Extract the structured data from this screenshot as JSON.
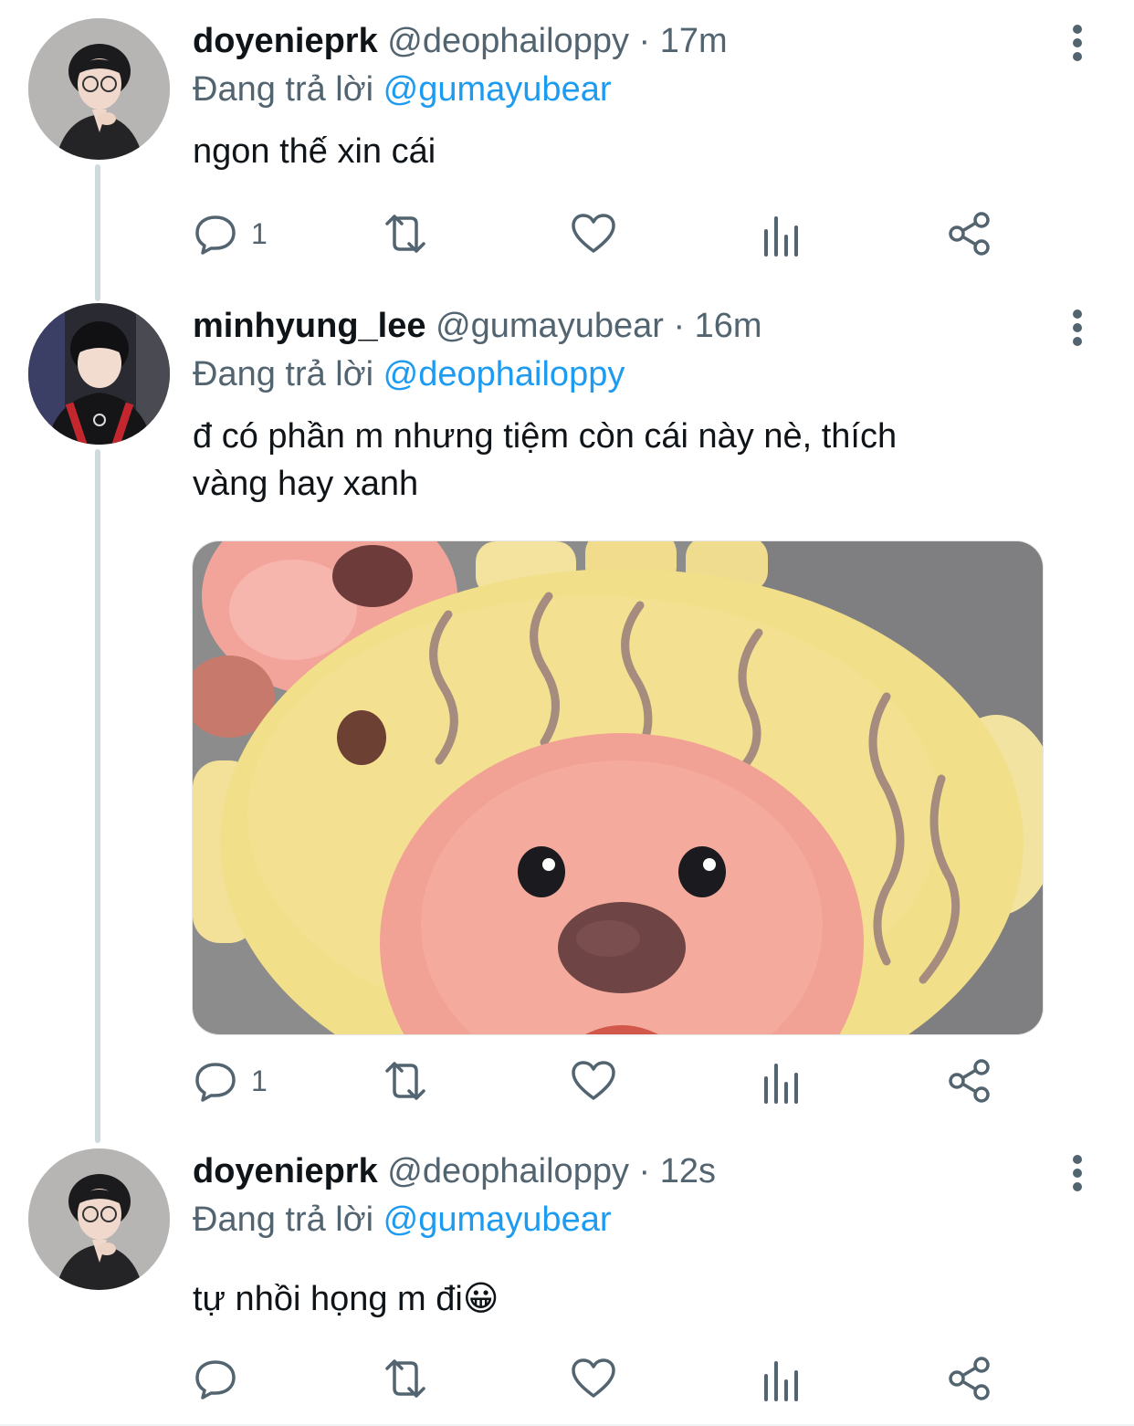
{
  "tweets": [
    {
      "name": "doyenieprk",
      "handle": "@deophailoppy",
      "time": "· 17m",
      "reply_prefix": "Đang trả lời",
      "reply_to": "@gumayubear",
      "text": "ngon thế xin cái",
      "reply_count": "1"
    },
    {
      "name": "minhyung_lee",
      "handle": "@gumayubear",
      "time": "· 16m",
      "reply_prefix": "Đang trả lời",
      "reply_to": "@deophailoppy",
      "text_line1": "đ có phần m nhưng tiệm còn cái này nè, thích",
      "text_line2": "vàng hay xanh",
      "reply_count": "1"
    },
    {
      "name": "doyenieprk",
      "handle": "@deophailoppy",
      "time": "· 12s",
      "reply_prefix": "Đang trả lời",
      "reply_to": "@gumayubear",
      "text": "tự nhồi họng m đi",
      "emoji": "😀",
      "reply_count": ""
    }
  ],
  "icons": {
    "reply": "reply-icon",
    "retweet": "retweet-icon",
    "like": "heart-icon",
    "views": "analytics-icon",
    "share": "share-icon",
    "more": "more-vertical-icon"
  },
  "colors": {
    "link": "#1d9bf0",
    "secondary_text": "#536471",
    "thread_line": "#cfd9de",
    "cake_yellow": "#f3e08a",
    "cake_pink": "#f3a89a"
  }
}
